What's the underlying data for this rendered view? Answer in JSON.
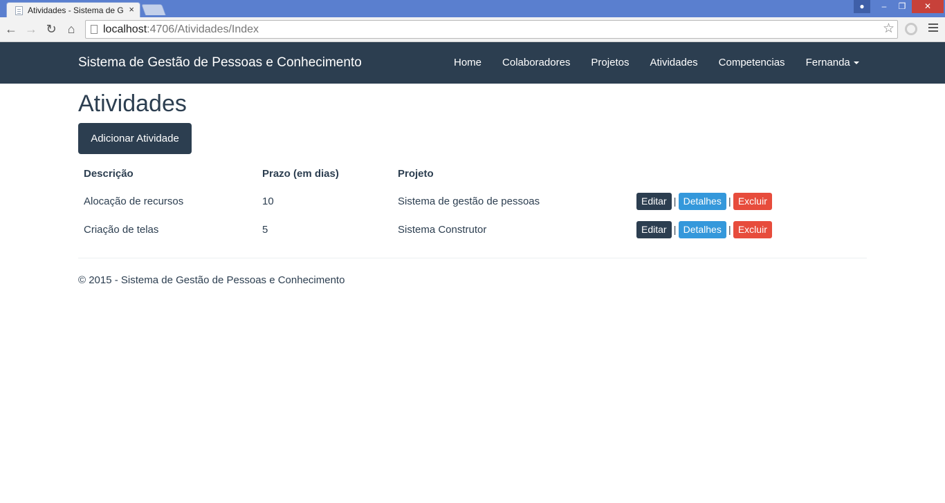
{
  "browser": {
    "tab_title": "Atividades - Sistema de G",
    "tab_close": "×",
    "url_host": "localhost",
    "url_path": ":4706/Atividades/Index"
  },
  "navbar": {
    "brand": "Sistema de Gestão de Pessoas e Conhecimento",
    "items": [
      {
        "label": "Home"
      },
      {
        "label": "Colaboradores"
      },
      {
        "label": "Projetos"
      },
      {
        "label": "Atividades"
      },
      {
        "label": "Competencias"
      }
    ],
    "user": "Fernanda"
  },
  "main": {
    "title": "Atividades",
    "add_button": "Adicionar Atividade",
    "table": {
      "headers": [
        "Descrição",
        "Prazo (em dias)",
        "Projeto"
      ],
      "rows": [
        {
          "descricao": "Alocação de recursos",
          "prazo": "10",
          "projeto": "Sistema de gestão de pessoas"
        },
        {
          "descricao": "Criação de telas",
          "prazo": "5",
          "projeto": "Sistema Construtor"
        }
      ],
      "actions": {
        "edit": "Editar",
        "details": "Detalhes",
        "delete": "Excluir",
        "separator": "|"
      }
    }
  },
  "footer": {
    "text": "© 2015 - Sistema de Gestão de Pessoas e Conhecimento"
  },
  "colors": {
    "primary": "#2c3e50",
    "info": "#3498db",
    "danger": "#e74c3c"
  }
}
